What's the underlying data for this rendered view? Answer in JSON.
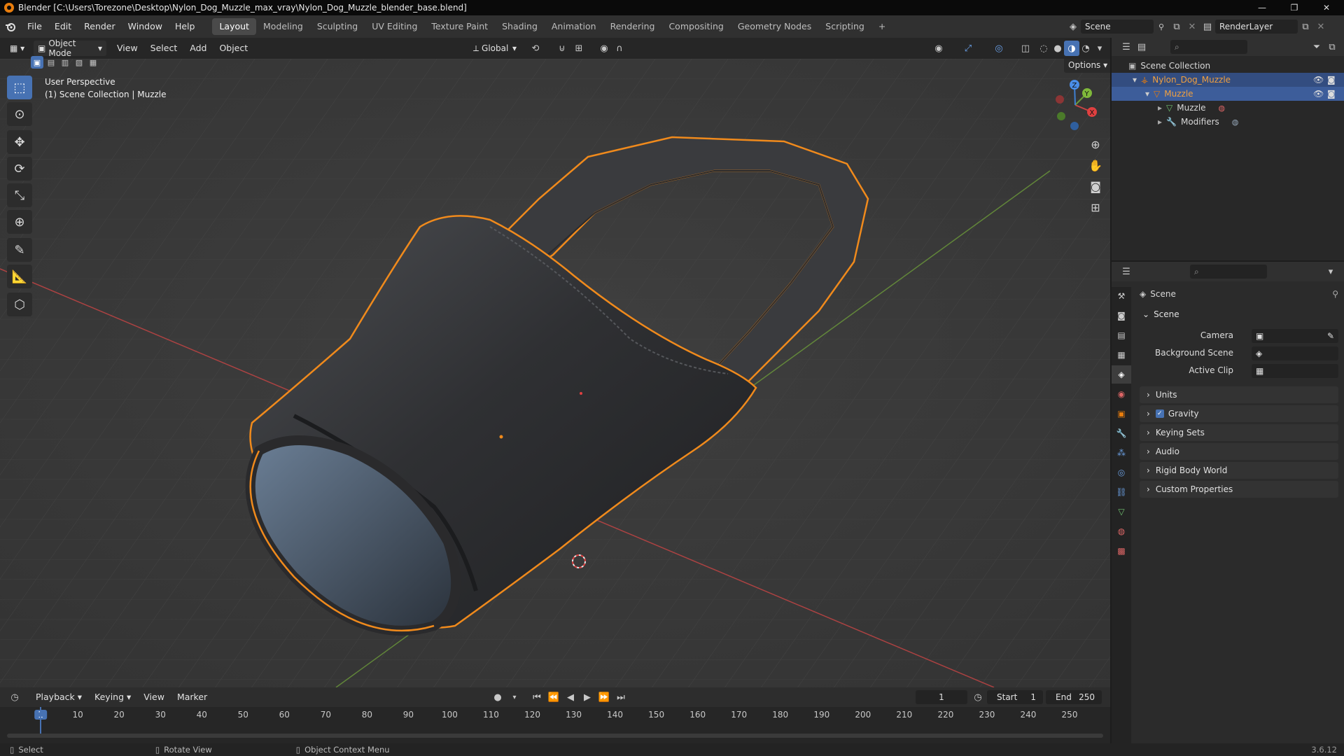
{
  "window": {
    "title": "Blender [C:\\Users\\Torezone\\Desktop\\Nylon_Dog_Muzzle_max_vray\\Nylon_Dog_Muzzle_blender_base.blend]",
    "controls": [
      "—",
      "❐",
      "✕"
    ]
  },
  "menu": [
    "File",
    "Edit",
    "Render",
    "Window",
    "Help"
  ],
  "workspaces": [
    {
      "label": "Layout",
      "active": true
    },
    {
      "label": "Modeling"
    },
    {
      "label": "Sculpting"
    },
    {
      "label": "UV Editing"
    },
    {
      "label": "Texture Paint"
    },
    {
      "label": "Shading"
    },
    {
      "label": "Animation"
    },
    {
      "label": "Rendering"
    },
    {
      "label": "Compositing"
    },
    {
      "label": "Geometry Nodes"
    },
    {
      "label": "Scripting"
    }
  ],
  "add_workspace": "+",
  "scene_selector": "Scene",
  "view_layer_selector": "RenderLayer",
  "viewport_header": {
    "mode": "Object Mode",
    "menus": [
      "View",
      "Select",
      "Add",
      "Object"
    ],
    "transform_orientation": "Global",
    "options": "Options"
  },
  "viewport": {
    "perspective_label": "User Perspective",
    "collection_label": "(1) Scene Collection | Muzzle"
  },
  "gizmo": {
    "x": "X",
    "y": "Y",
    "z": "Z"
  },
  "outliner": {
    "rows": [
      {
        "label": "Scene Collection",
        "indent": 0
      },
      {
        "label": "Nylon_Dog_Muzzle",
        "indent": 1
      },
      {
        "label": "Muzzle",
        "indent": 2
      },
      {
        "label": "Muzzle",
        "indent": 3
      },
      {
        "label": "Modifiers",
        "indent": 3
      }
    ]
  },
  "properties": {
    "header": "Scene",
    "section": "Scene",
    "fields": [
      {
        "label": "Camera"
      },
      {
        "label": "Background Scene"
      },
      {
        "label": "Active Clip"
      }
    ],
    "panels": [
      "Units",
      "Gravity",
      "Keying Sets",
      "Audio",
      "Rigid Body World",
      "Custom Properties"
    ],
    "gravity_checked": true
  },
  "timeline": {
    "menus": [
      "Playback",
      "Keying",
      "View",
      "Marker"
    ],
    "current_frame": "1",
    "start_label": "Start",
    "start": "1",
    "end_label": "End",
    "end": "250",
    "ticks": [
      "1",
      "10",
      "20",
      "30",
      "40",
      "50",
      "60",
      "70",
      "80",
      "90",
      "100",
      "110",
      "120",
      "130",
      "140",
      "150",
      "160",
      "170",
      "180",
      "190",
      "200",
      "210",
      "220",
      "230",
      "240",
      "250"
    ]
  },
  "statusbar": {
    "items": [
      "Select",
      "Rotate View",
      "Object Context Menu"
    ],
    "version": "3.6.12"
  },
  "colors": {
    "accent": "#4772b3",
    "selection_outline": "#f08a1c",
    "x_axis": "#c94545",
    "y_axis": "#6c9a3a",
    "z_axis": "#3f7fd1"
  }
}
